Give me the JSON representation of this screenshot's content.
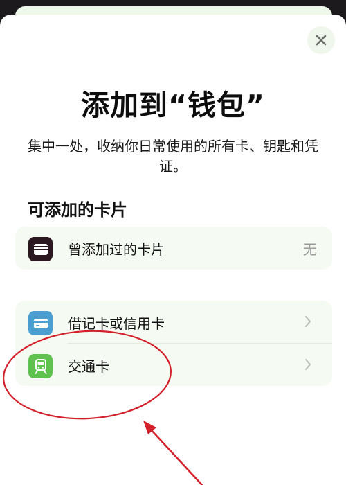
{
  "sheet": {
    "title": "添加到“钱包”",
    "subtitle": "集中一处，收纳你日常使用的所有卡、钥匙和凭证。",
    "close_icon": "close-icon"
  },
  "section": {
    "heading": "可添加的卡片"
  },
  "previous_cards": {
    "label": "曾添加过的卡片",
    "value": "无",
    "icon": "wallet-card-icon"
  },
  "card_types": [
    {
      "label": "借记卡或信用卡",
      "icon": "credit-card-icon",
      "chevron": "chevron-right-icon"
    },
    {
      "label": "交通卡",
      "icon": "train-icon",
      "chevron": "chevron-right-icon"
    }
  ],
  "colors": {
    "wallet_icon_bg": "#2b171f",
    "credit_card_icon_bg": "#4a9ed0",
    "transit_icon_bg": "#5fc24f",
    "annotation": "#d3202a"
  }
}
